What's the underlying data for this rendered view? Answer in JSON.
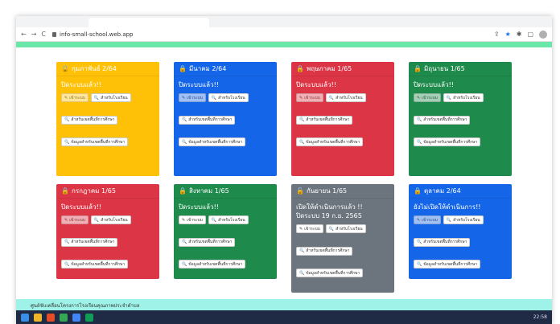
{
  "browser": {
    "url": "info-small-school.web.app",
    "nav_back": "←",
    "nav_forward": "→",
    "nav_reload": "C"
  },
  "cards": [
    {
      "title": "กุมภาพันธ์ 2/64",
      "status": "ปิดระบบแล้ว!!",
      "icon": "lock",
      "btn1": "เข้าระบบ",
      "btn2": "สำหรับโรงเรียน",
      "btn3": "สำหรับเขตพื้นที่การศึกษา",
      "btn4": "ข้อมูลสำหรับเขตพื้นที่การศึกษา"
    },
    {
      "title": "มีนาคม 2/64",
      "status": "ปิดระบบแล้ว!!",
      "icon": "lock",
      "btn1": "เข้าระบบ",
      "btn2": "สำหรับโรงเรียน",
      "btn3": "สำหรับเขตพื้นที่การศึกษา",
      "btn4": "ข้อมูลสำหรับเขตพื้นที่การศึกษา"
    },
    {
      "title": "พฤษภาคม 1/65",
      "status": "ปิดระบบแล้ว!!",
      "icon": "lock",
      "btn1": "เข้าระบบ",
      "btn2": "สำหรับโรงเรียน",
      "btn3": "สำหรับเขตพื้นที่การศึกษา",
      "btn4": "ข้อมูลสำหรับเขตพื้นที่การศึกษา"
    },
    {
      "title": "มิถุนายน 1/65",
      "status": "ปิดระบบแล้ว!!",
      "icon": "lock",
      "btn1": "เข้าระบบ",
      "btn2": "สำหรับโรงเรียน",
      "btn3": "สำหรับเขตพื้นที่การศึกษา",
      "btn4": "ข้อมูลสำหรับเขตพื้นที่การศึกษา"
    },
    {
      "title": "กรกฎาคม 1/65",
      "status": "ปิดระบบแล้ว!!",
      "icon": "lock",
      "btn1": "เข้าระบบ",
      "btn2": "สำหรับโรงเรียน",
      "btn3": "สำหรับเขตพื้นที่การศึกษา",
      "btn4": "ข้อมูลสำหรับเขตพื้นที่การศึกษา"
    },
    {
      "title": "สิงหาคม 1/65",
      "status": "ปิดระบบแล้ว!!",
      "icon": "lock",
      "btn1": "เข้าระบบ",
      "btn2": "สำหรับโรงเรียน",
      "btn3": "สำหรับเขตพื้นที่การศึกษา",
      "btn4": "ข้อมูลสำหรับเขตพื้นที่การศึกษา"
    },
    {
      "title": "กันยายน 1/65",
      "status": "เปิดให้ดำเนินการแล้ว !!",
      "status2": "ปิดระบบ 19 ก.ย. 2565",
      "icon": "unlock",
      "btn1": "เข้าระบบ",
      "btn2": "สำหรับโรงเรียน",
      "btn3": "สำหรับเขตพื้นที่การศึกษา",
      "btn4": "ข้อมูลสำหรับเขตพื้นที่การศึกษา"
    },
    {
      "title": "ตุลาคม 2/64",
      "status": "ยังไม่เปิดให้ดำเนินการ!!",
      "icon": "lock",
      "btn1": "เข้าระบบ",
      "btn2": "สำหรับโรงเรียน",
      "btn3": "สำหรับเขตพื้นที่การศึกษา",
      "btn4": "ข้อมูลสำหรับเขตพื้นที่การศึกษา"
    }
  ],
  "footer": {
    "text": "ศูนย์ขับเคลื่อนโครงการโรงเรียนคุณภาพประจำตำบล"
  },
  "taskbar": {
    "clock": "22:58"
  },
  "colors": {
    "yellow": "#ffc107",
    "blue": "#1565e8",
    "red": "#dc3545",
    "green": "#1e8a4c",
    "gray": "#6c757d",
    "topbar": "#6ae6a8",
    "footer": "#9ef2e7"
  }
}
